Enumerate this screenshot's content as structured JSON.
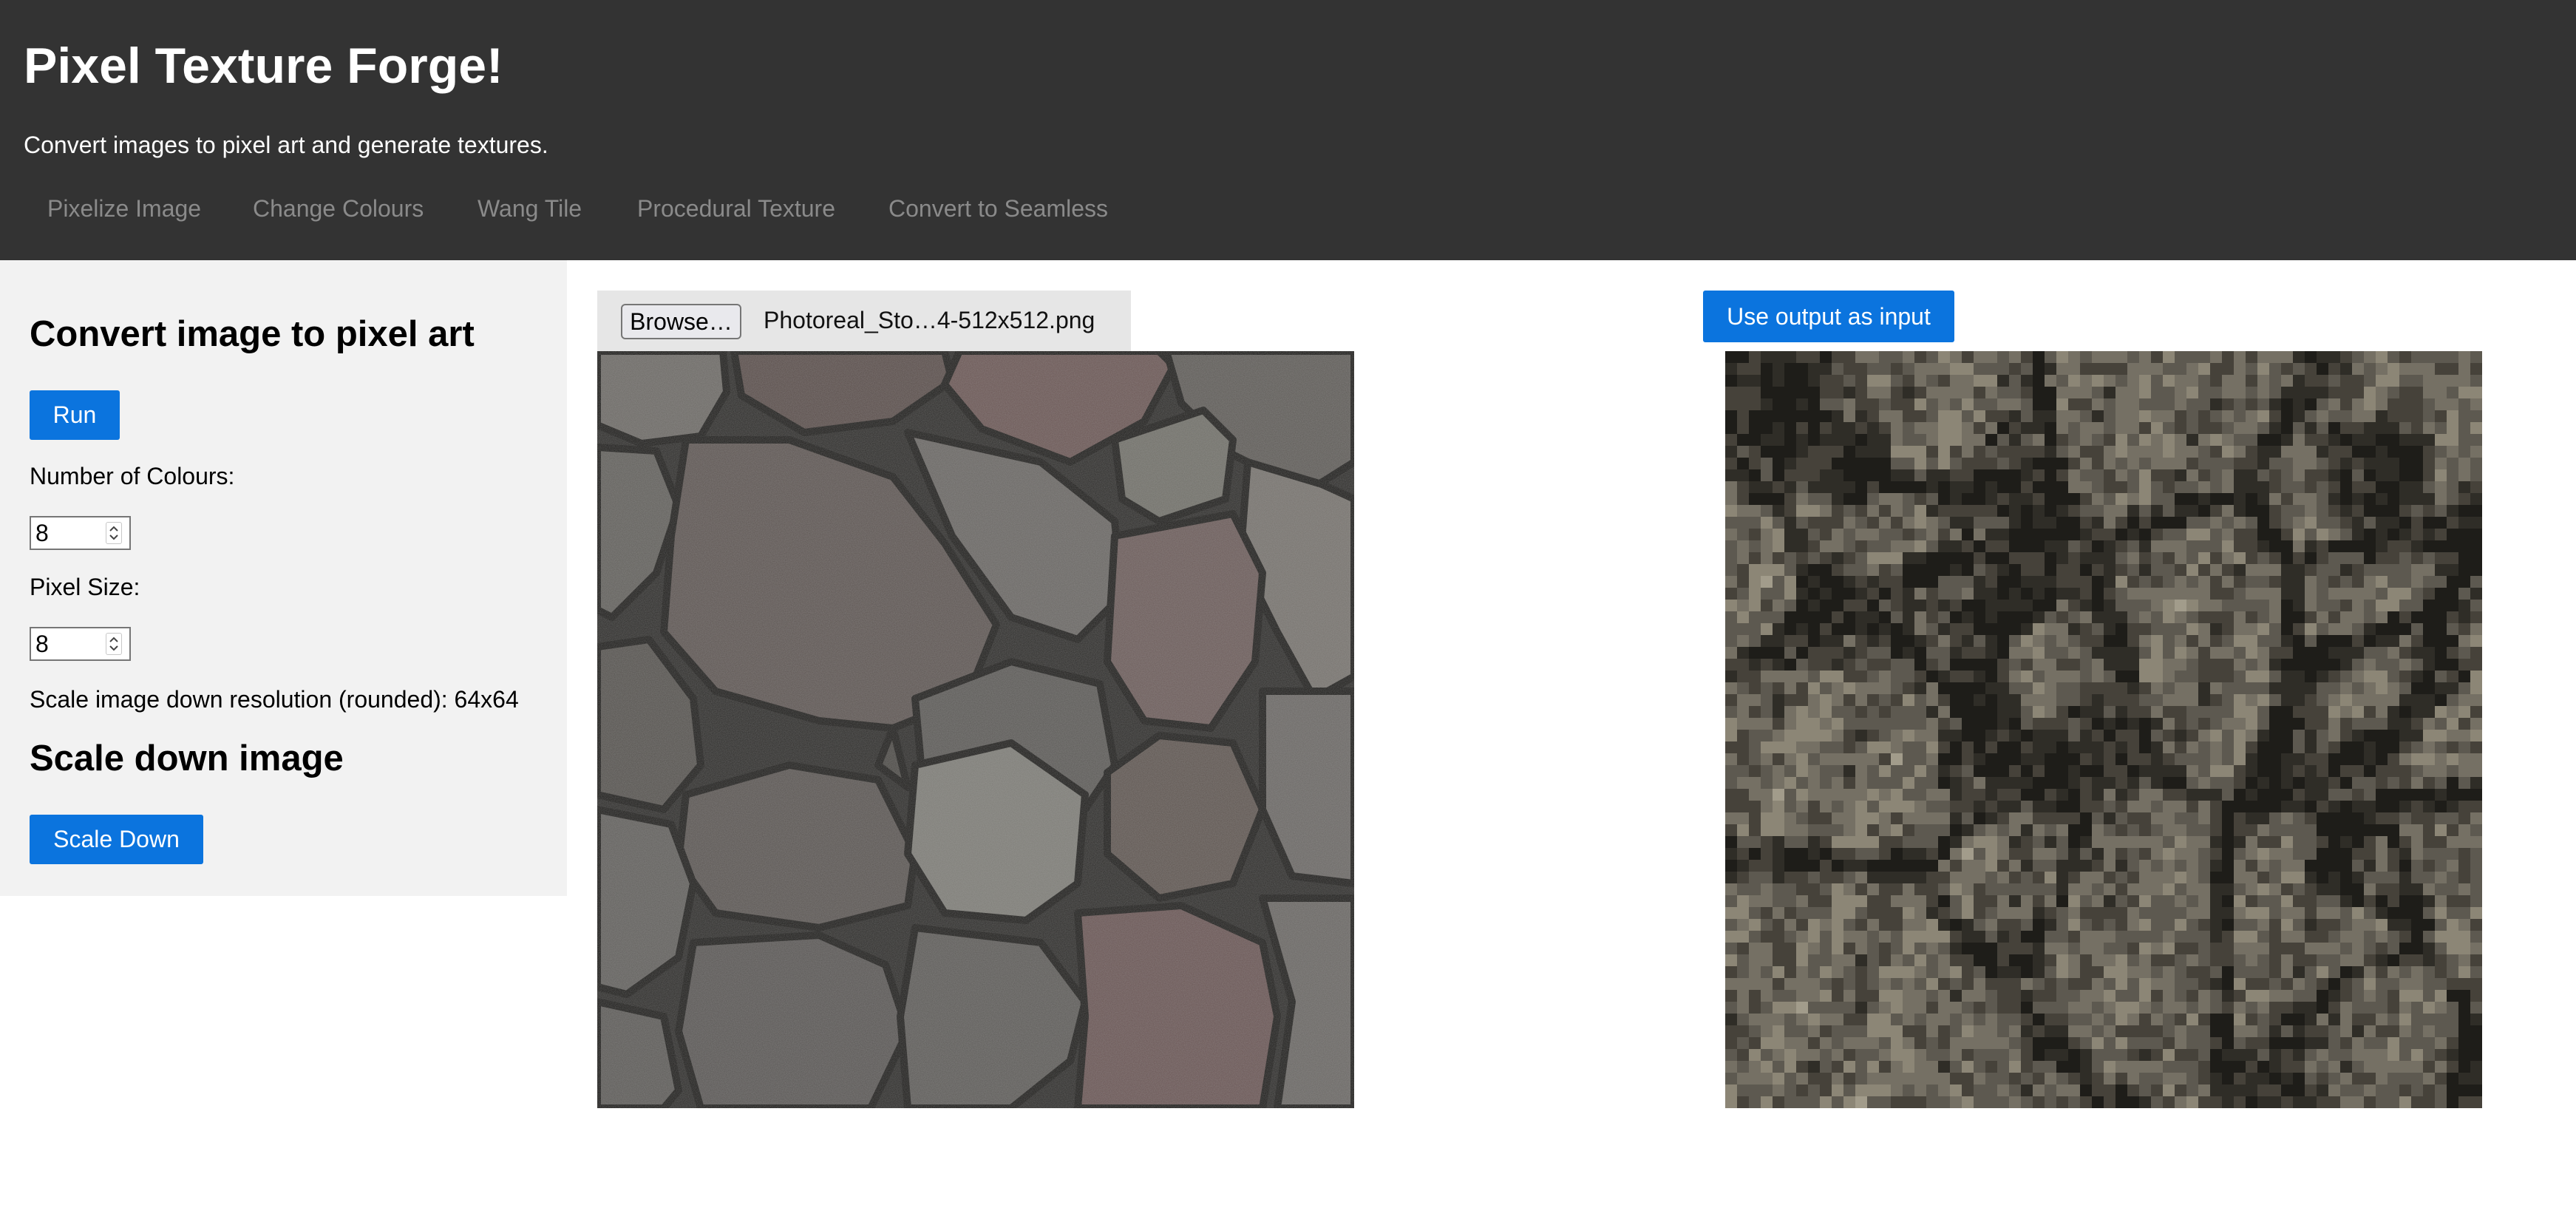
{
  "header": {
    "title": "Pixel Texture Forge!",
    "subtitle": "Convert images to pixel art and generate textures."
  },
  "nav": {
    "items": [
      {
        "label": "Pixelize Image"
      },
      {
        "label": "Change Colours"
      },
      {
        "label": "Wang Tile"
      },
      {
        "label": "Procedural Texture"
      },
      {
        "label": "Convert to Seamless"
      }
    ]
  },
  "sidebar": {
    "heading": "Convert image to pixel art",
    "run_label": "Run",
    "colours_label": "Number of Colours:",
    "colours_value": "8",
    "pixel_size_label": "Pixel Size:",
    "pixel_size_value": "8",
    "resolution_text": "Scale image down resolution (rounded): 64x64",
    "scale_heading": "Scale down image",
    "scale_button_label": "Scale Down"
  },
  "input": {
    "browse_label": "Browse…",
    "file_name": "Photoreal_Sto…4-512x512.png"
  },
  "output": {
    "use_output_label": "Use output as input"
  },
  "colors": {
    "header_bg": "#333333",
    "sidebar_bg": "#f2f2f2",
    "accent": "#0b74de",
    "nav_text": "#8a8a8a"
  }
}
